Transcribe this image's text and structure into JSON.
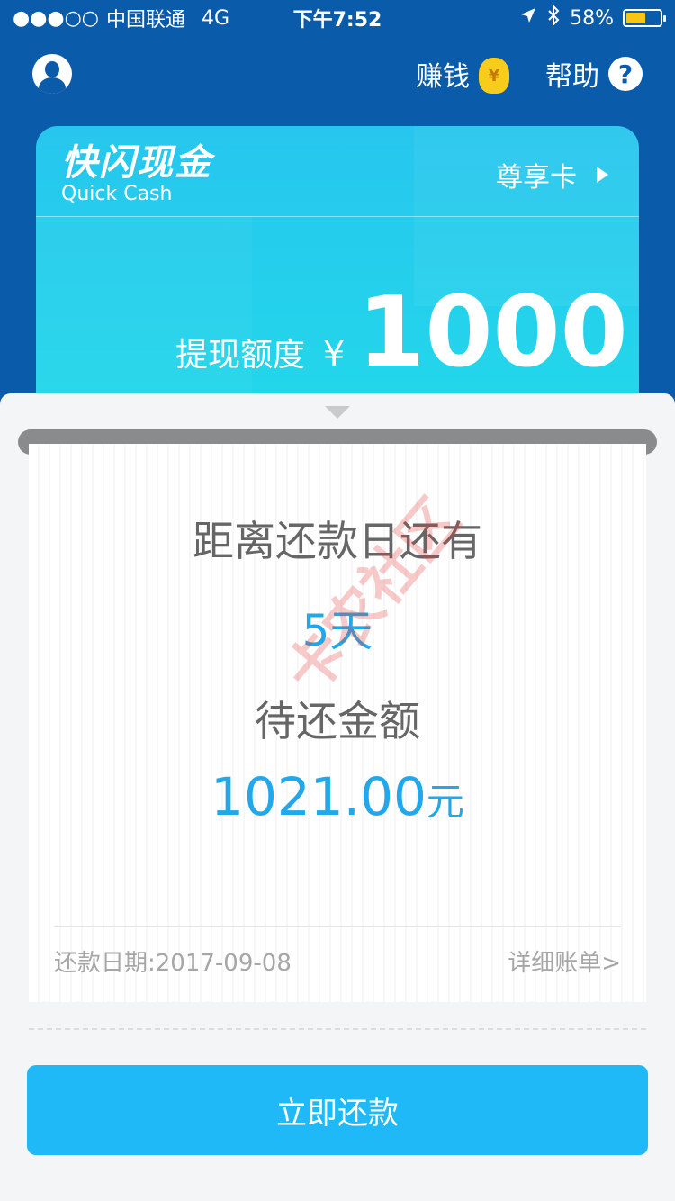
{
  "status_bar": {
    "signal": "●●●○○",
    "carrier": "中国联通",
    "network": "4G",
    "time": "下午7:52",
    "battery_percent": "58%",
    "battery_level": 0.58,
    "location_icon": "location-arrow-icon",
    "bluetooth_icon": "bluetooth-icon"
  },
  "nav": {
    "earn_label": "赚钱",
    "earn_icon_glyph": "¥",
    "help_label": "帮助",
    "help_icon_glyph": "?"
  },
  "card": {
    "brand_cn": "快闪现金",
    "brand_en": "Quick Cash",
    "vip_label": "尊享卡",
    "limit_label": "提现额度",
    "currency": "¥",
    "limit_amount": "1000"
  },
  "receipt": {
    "days_title": "距离还款日还有",
    "days_value": "5天",
    "amount_title": "待还金额",
    "amount_value": "1021.00",
    "amount_unit": "元",
    "due_date": "还款日期:2017-09-08",
    "detail_link": "详细账单>",
    "watermark": "卡农社区"
  },
  "actions": {
    "repay_label": "立即还款"
  },
  "colors": {
    "header_bg": "#0b5bab",
    "card_bg": "#22d8ea",
    "accent": "#22a8ea",
    "button_bg": "#20b9f8",
    "battery": "#f5c518"
  }
}
